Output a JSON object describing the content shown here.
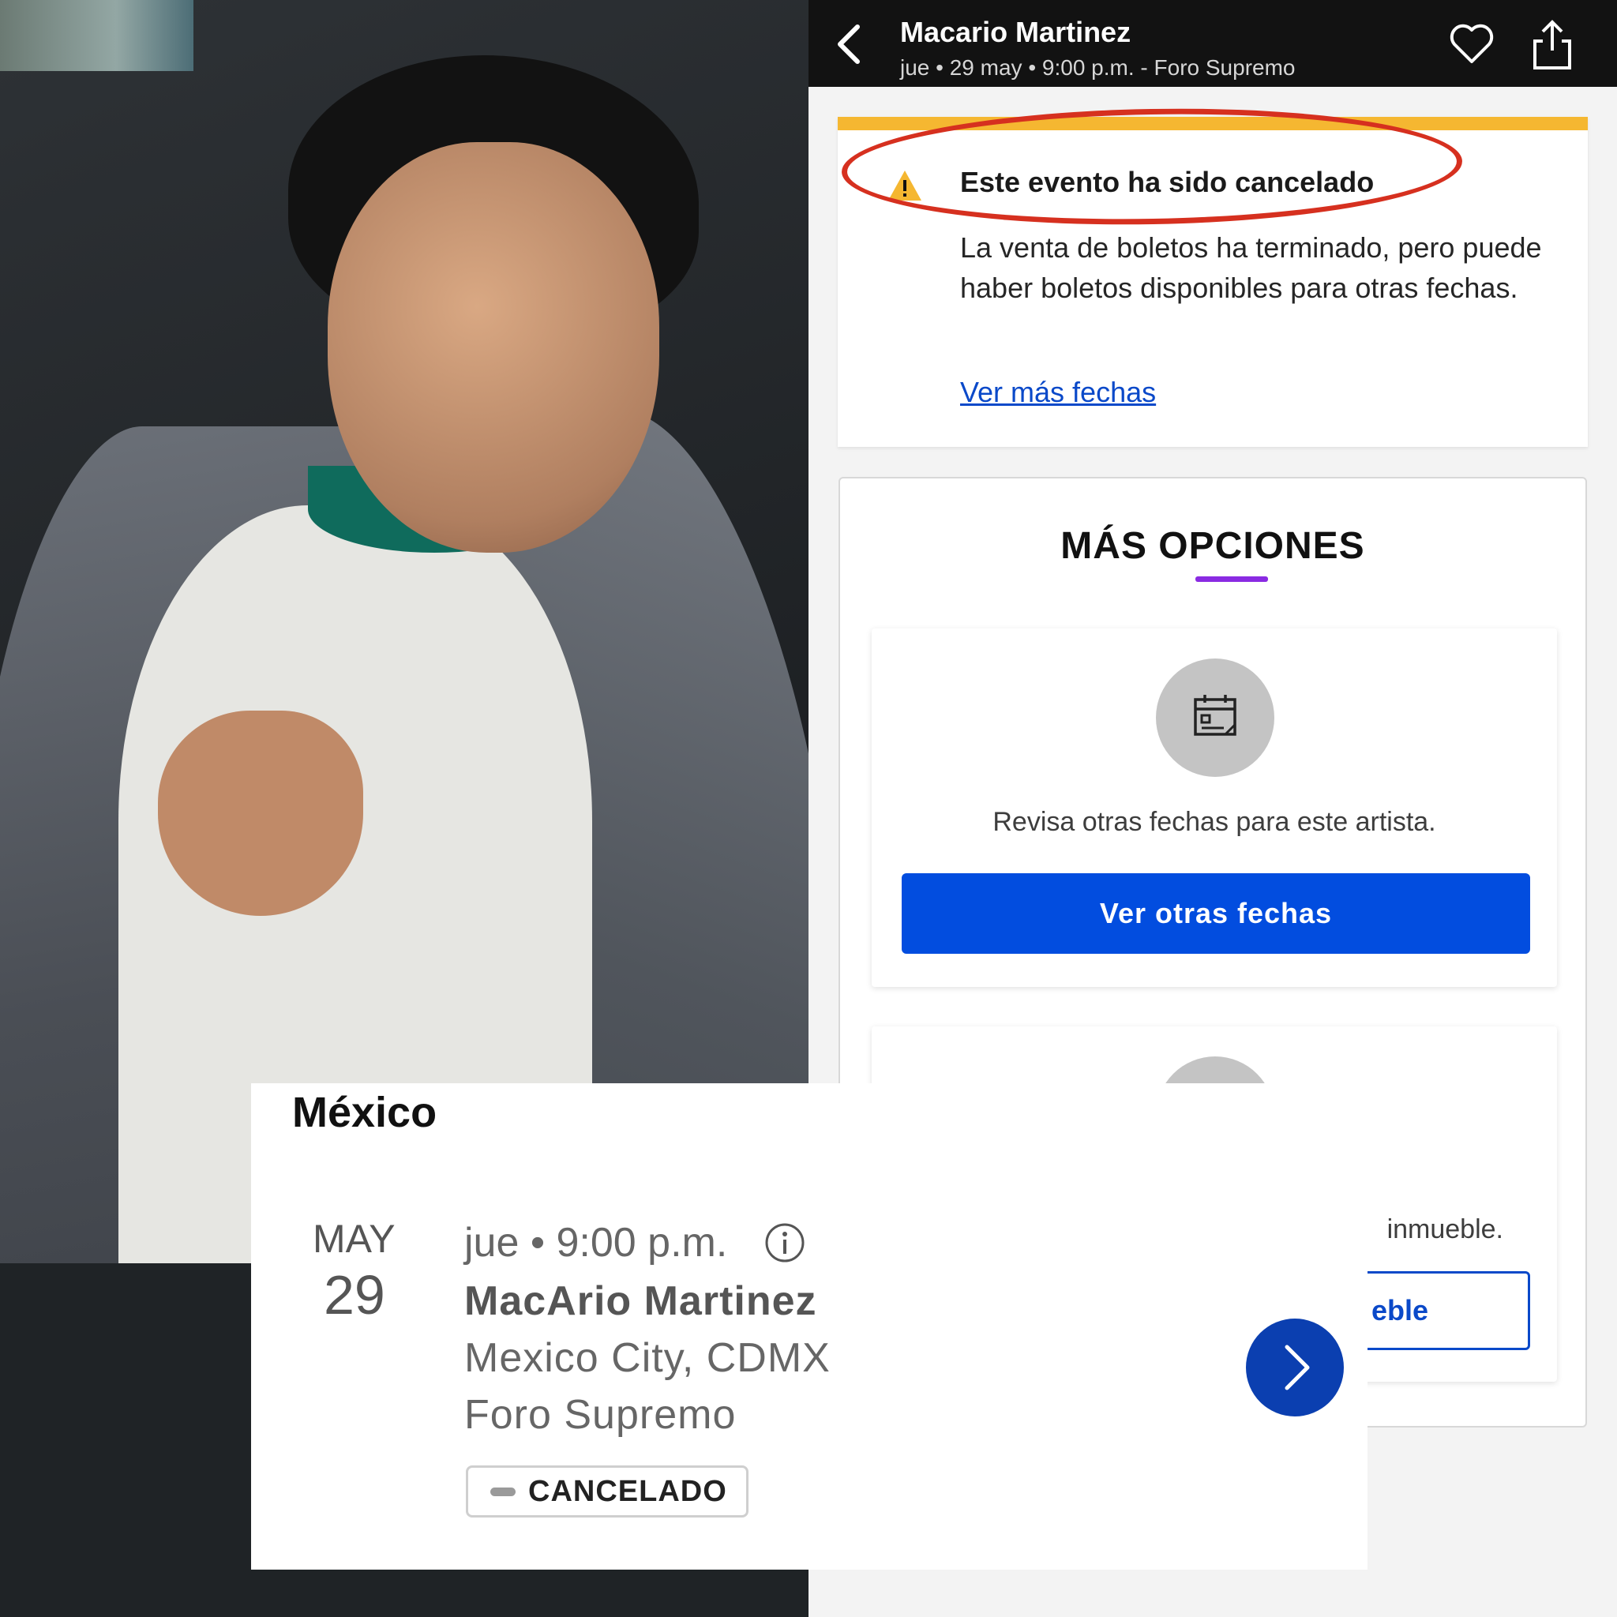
{
  "topbar": {
    "title": "Macario Martinez",
    "subtitle": "jue • 29 may • 9:00 p.m. - Foro Supremo"
  },
  "alert": {
    "heading": "Este evento ha sido cancelado",
    "body": "La venta de boletos ha terminado, pero puede haber boletos disponibles para otras fechas.",
    "link": "Ver más fechas",
    "stripe_color": "#f5b731"
  },
  "options": {
    "heading": "MÁS OPCIONES",
    "card1": {
      "icon": "calendar-icon",
      "text": "Revisa otras fechas para este artista.",
      "button": "Ver otras fechas"
    },
    "card2": {
      "text_partial": "inmueble.",
      "button_partial": "eble"
    }
  },
  "listing": {
    "country": "México",
    "month": "MAY",
    "day": "29",
    "time": "jue • 9:00 p.m.",
    "artist": "MacArio Martinez",
    "city": "Mexico City, CDMX",
    "venue": "Foro Supremo",
    "status": "CANCELADO"
  },
  "colors": {
    "primary_button": "#024ddf",
    "link": "#0a49c9",
    "accent_underline": "#8a2be2",
    "highlight_ring": "#d6301f"
  }
}
